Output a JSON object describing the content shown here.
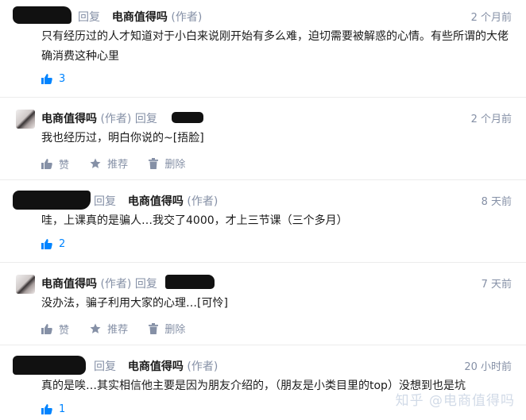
{
  "comments": [
    {
      "reply_label": "回复",
      "reply_to": "电商值得吗",
      "author_tag": "(作者)",
      "time": "2 个月前",
      "content": "只有经历过的人才知道对于小白来说刚开始有多么难，迫切需要被解惑的心情。有些所谓的大佬确消费这种心里",
      "likes": "3"
    },
    {
      "author": "电商值得吗",
      "author_tag": "(作者)",
      "reply_label": "回复",
      "time": "2 个月前",
      "content": "我也经历过，明白你说的~[捂脸]",
      "like_label": "赞",
      "recommend_label": "推荐",
      "delete_label": "删除"
    },
    {
      "reply_label": "回复",
      "reply_to": "电商值得吗",
      "author_tag": "(作者)",
      "time": "8 天前",
      "content": "哇，上课真的是骗人…我交了4000，才上三节课（三个多月）",
      "likes": "2"
    },
    {
      "author": "电商值得吗",
      "author_tag": "(作者)",
      "reply_label": "回复",
      "time": "7 天前",
      "content": "没办法，骗子利用大家的心理…[可怜]",
      "like_label": "赞",
      "recommend_label": "推荐",
      "delete_label": "删除"
    },
    {
      "reply_label": "回复",
      "reply_to": "电商值得吗",
      "author_tag": "(作者)",
      "time": "20 小时前",
      "content": "真的是唉…其实相信他主要是因为朋友介绍的，（朋友是小类目里的top）没想到也是坑",
      "likes": "1"
    }
  ],
  "watermark": "知乎 @电商值得吗",
  "colors": {
    "accent": "#0084ff",
    "meta": "#8590a6",
    "text": "#1a1a1a"
  }
}
